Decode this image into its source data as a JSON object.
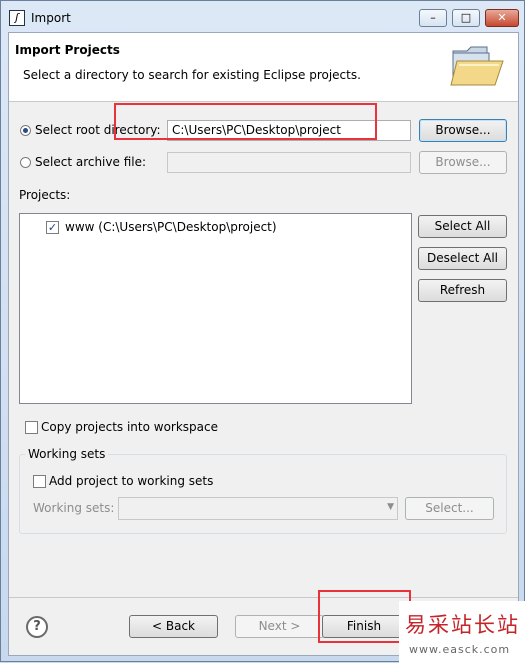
{
  "window": {
    "title": "Import",
    "controls": {
      "minimize": "–",
      "maximize": "□",
      "close": "✕"
    }
  },
  "header": {
    "title": "Import Projects",
    "description": "Select a directory to search for existing Eclipse projects."
  },
  "root_directory": {
    "label": "Select root directory:",
    "value": "C:\\Users\\PC\\Desktop\\project",
    "browse_label": "Browse...",
    "selected": true
  },
  "archive_file": {
    "label": "Select archive file:",
    "value": "",
    "browse_label": "Browse...",
    "selected": false
  },
  "projects": {
    "label": "Projects:",
    "items": [
      {
        "label": "www (C:\\Users\\PC\\Desktop\\project)",
        "checked": true
      }
    ],
    "select_all_label": "Select All",
    "deselect_all_label": "Deselect All",
    "refresh_label": "Refresh"
  },
  "copy_projects": {
    "label": "Copy projects into workspace",
    "checked": false
  },
  "working_sets": {
    "group_title": "Working sets",
    "add_label": "Add project to working sets",
    "add_checked": false,
    "field_label": "Working sets:",
    "select_label": "Select..."
  },
  "footer": {
    "help": "?",
    "back_label": "< Back",
    "next_label": "Next >",
    "finish_label": "Finish"
  },
  "watermark": {
    "text": "易采站长站",
    "url": "www.easck.com"
  },
  "colors": {
    "highlight": "#e8333a",
    "accent": "#2b4a87"
  }
}
